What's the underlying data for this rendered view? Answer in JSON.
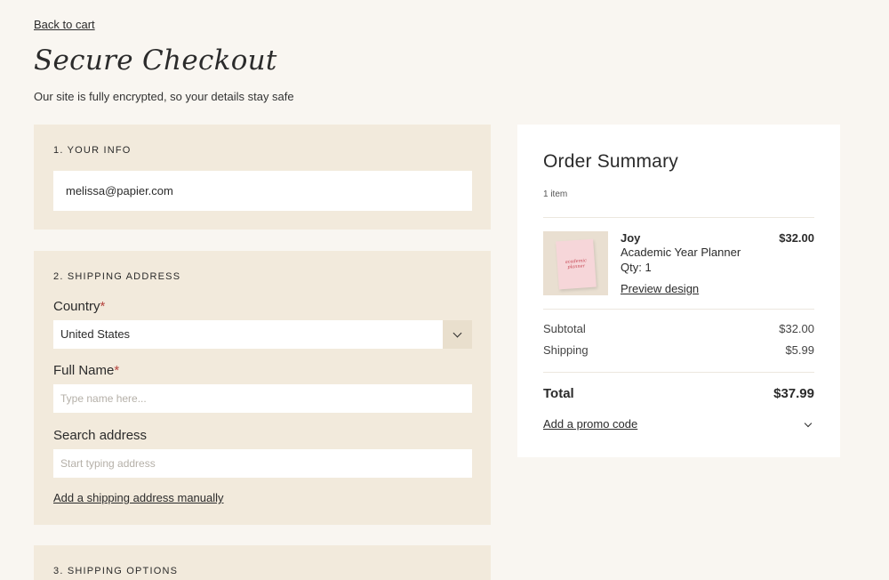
{
  "header": {
    "back_label": "Back to cart",
    "title": "Secure Checkout",
    "subtitle": "Our site is fully encrypted, so your details stay safe"
  },
  "your_info": {
    "heading": "1. YOUR INFO",
    "email_value": "melissa@papier.com"
  },
  "shipping_address": {
    "heading": "2. SHIPPING ADDRESS",
    "country_label": "Country",
    "country_value": "United States",
    "full_name_label": "Full Name",
    "full_name_placeholder": "Type name here...",
    "search_label": "Search address",
    "search_placeholder": "Start typing address",
    "manual_link": "Add a shipping address manually",
    "required_marker": "*"
  },
  "shipping_options": {
    "heading": "3. SHIPPING OPTIONS"
  },
  "order_summary": {
    "title": "Order Summary",
    "item_count": "1 item",
    "item": {
      "name": "Joy",
      "product": "Academic Year Planner",
      "qty": "Qty: 1",
      "preview_label": "Preview design",
      "price": "$32.00",
      "thumb_text": "academic planner"
    },
    "subtotal_label": "Subtotal",
    "subtotal_value": "$32.00",
    "shipping_label": "Shipping",
    "shipping_value": "$5.99",
    "total_label": "Total",
    "total_value": "$37.99",
    "promo_label": "Add a promo code"
  },
  "icons": {
    "country_dropdown": "chevron-down-icon",
    "promo_expand": "chevron-down-icon"
  },
  "colors": {
    "page_bg": "#f9f6f1",
    "panel_bg": "#f2eadc",
    "required": "#b5453f"
  }
}
